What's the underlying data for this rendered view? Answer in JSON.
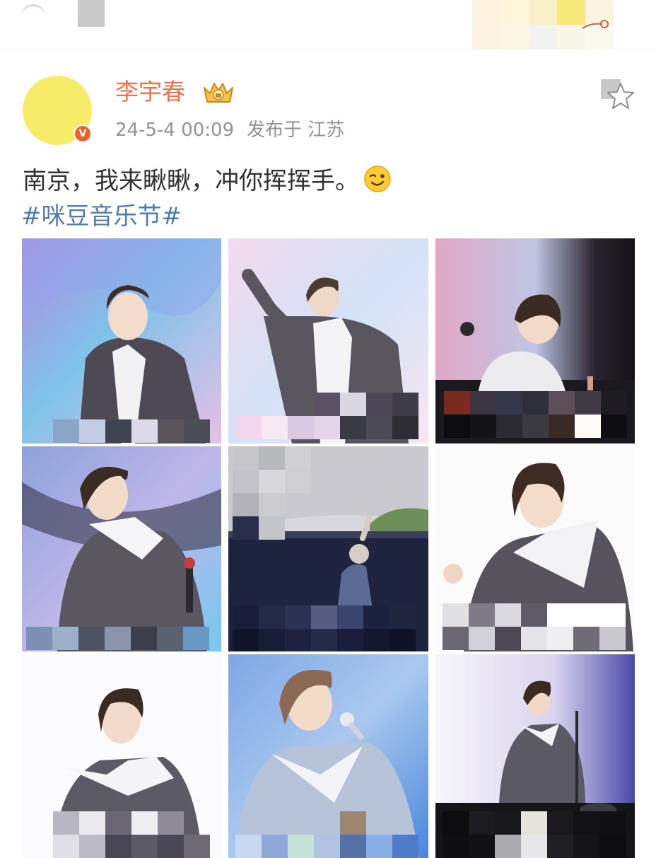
{
  "post": {
    "username": "李宇春",
    "timestamp": "24-5-4 00:09",
    "location": "发布于 江苏",
    "text": "南京，我来瞅瞅，冲你挥挥手。",
    "hashtag": "#咪豆音乐节#",
    "icons": {
      "verified": "verified-badge-icon",
      "crown": "crown-badge-icon",
      "star": "star-icon",
      "emoji": "wink-emoji-icon"
    }
  },
  "colors": {
    "username": "#eb7350",
    "hashtag": "#507daf",
    "meta": "#939393",
    "text": "#333333",
    "avatar": "#f6ec6a",
    "badge": "#e8602c"
  },
  "photos": [
    {
      "name": "photo-1",
      "description": "performer-singing-with-microphone"
    },
    {
      "name": "photo-2",
      "description": "performer-waving-hand"
    },
    {
      "name": "photo-3",
      "description": "performer-on-stage-looking-down"
    },
    {
      "name": "photo-4",
      "description": "performer-closeup-holding-microphone"
    },
    {
      "name": "photo-5",
      "description": "performer-waving-outdoors"
    },
    {
      "name": "photo-6",
      "description": "performer-portrait-raised-fist"
    },
    {
      "name": "photo-7",
      "description": "performer-looking-up"
    },
    {
      "name": "photo-8",
      "description": "performer-singing-smiling"
    },
    {
      "name": "photo-9",
      "description": "performer-on-stage-with-band"
    }
  ]
}
